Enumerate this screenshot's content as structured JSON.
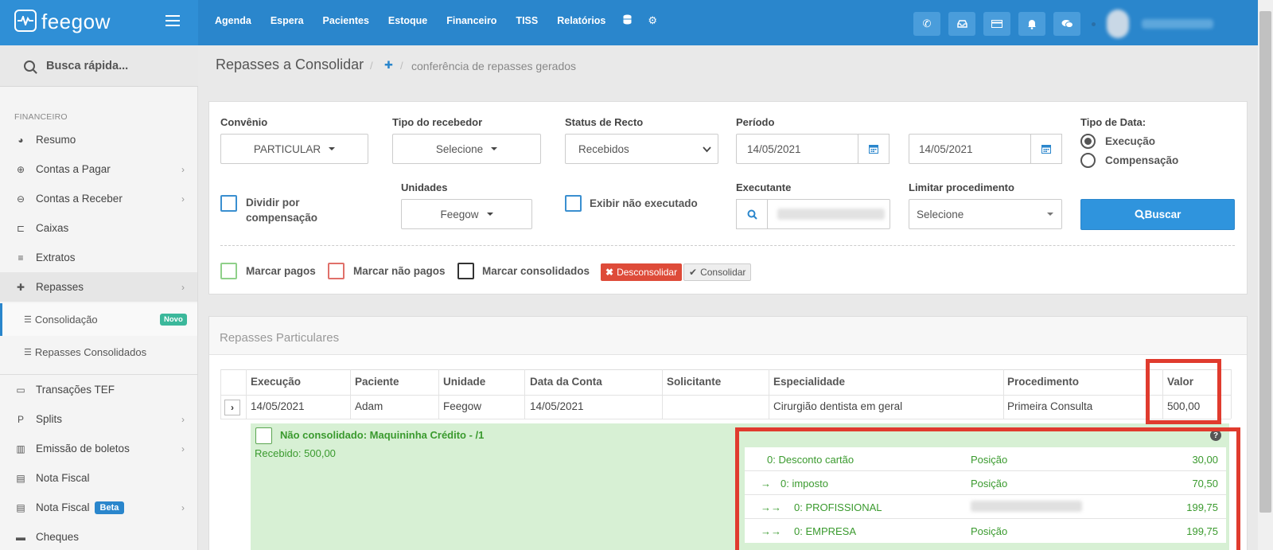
{
  "brand": {
    "name": "feegow"
  },
  "topnav": {
    "items": [
      "Agenda",
      "Espera",
      "Pacientes",
      "Estoque",
      "Financeiro",
      "TISS",
      "Relatórios"
    ],
    "icons": [
      "database-icon",
      "gear-icon"
    ],
    "right_icons": [
      "phone-icon",
      "inbox-icon",
      "card-icon",
      "bell-icon",
      "chat-icon"
    ]
  },
  "sidebar": {
    "search_label": "Busca rápida...",
    "section": "FINANCEIRO",
    "items": [
      {
        "label": "Resumo",
        "icon": "pie-chart-icon",
        "chevron": false
      },
      {
        "label": "Contas a Pagar",
        "icon": "arrow-up-circle-icon",
        "chevron": true
      },
      {
        "label": "Contas a Receber",
        "icon": "arrow-down-circle-icon",
        "chevron": true
      },
      {
        "label": "Caixas",
        "icon": "inbox-icon",
        "chevron": false
      },
      {
        "label": "Extratos",
        "icon": "list-icon",
        "chevron": false
      },
      {
        "label": "Repasses",
        "icon": "puzzle-icon",
        "chevron": true
      }
    ],
    "sub_items": [
      {
        "label": "Consolidação",
        "badge": "Novo"
      },
      {
        "label": "Repasses Consolidados"
      }
    ],
    "items_after": [
      {
        "label": "Transações TEF",
        "icon": "credit-card-icon",
        "chevron": false
      },
      {
        "label": "Splits",
        "icon": "split-icon",
        "chevron": true
      },
      {
        "label": "Emissão de boletos",
        "icon": "barcode-icon",
        "chevron": true
      },
      {
        "label": "Nota Fiscal",
        "icon": "file-icon",
        "chevron": false
      },
      {
        "label": "Nota Fiscal",
        "icon": "file-icon",
        "chevron": true,
        "badge": "Beta"
      },
      {
        "label": "Cheques",
        "icon": "check-book-icon",
        "chevron": false
      }
    ]
  },
  "page": {
    "title": "Repasses a Consolidar",
    "breadcrumb": "conferência de repasses gerados"
  },
  "filters": {
    "convenio_label": "Convênio",
    "convenio_value": "PARTICULAR",
    "tipo_recebedor_label": "Tipo do recebedor",
    "tipo_recebedor_value": "Selecione",
    "status_label": "Status de Recto",
    "status_value": "Recebidos",
    "periodo_label": "Período",
    "periodo_inicio": "14/05/2021",
    "periodo_fim": "14/05/2021",
    "tipo_data_label": "Tipo de Data:",
    "tipo_data_options": [
      "Execução",
      "Compensação"
    ],
    "tipo_data_selected": "Execução",
    "dividir_label": "Dividir por compensação",
    "unidades_label": "Unidades",
    "unidades_value": "Feegow",
    "exibir_nao_exec_label": "Exibir não executado",
    "executante_label": "Executante",
    "limitar_label": "Limitar procedimento",
    "limitar_value": "Selecione",
    "buscar_label": "Buscar"
  },
  "marks": {
    "pagos": "Marcar pagos",
    "nao_pagos": "Marcar não pagos",
    "consolidados": "Marcar consolidados",
    "desconsolidar": "Desconsolidar",
    "consolidar": "Consolidar",
    "colors": {
      "pagos": "#5cb85c",
      "nao_pagos": "#d9534f",
      "consolidados": "#333333"
    }
  },
  "table": {
    "section_title": "Repasses Particulares",
    "columns": [
      "Execução",
      "Paciente",
      "Unidade",
      "Data da Conta",
      "Solicitante",
      "Especialidade",
      "Procedimento",
      "Valor"
    ],
    "rows": [
      [
        "14/05/2021",
        "Adam",
        "Feegow",
        "14/05/2021",
        "",
        "Cirurgião dentista em geral",
        "Primeira Consulta",
        "500,00"
      ]
    ]
  },
  "detail": {
    "title": "Não consolidado: Maquininha Crédito - /1",
    "received": "Recebido: 500,00",
    "lines": [
      {
        "arrows": "",
        "label": "0: Desconto cartão",
        "type": "Posição",
        "value": "30,00"
      },
      {
        "arrows": "→",
        "label": "0: imposto",
        "type": "Posição",
        "value": "70,50"
      },
      {
        "arrows": "→→",
        "label": "0: PROFISSIONAL",
        "type": "",
        "value": "199,75"
      },
      {
        "arrows": "→→",
        "label": "0: EMPRESA",
        "type": "Posição",
        "value": "199,75"
      }
    ]
  }
}
